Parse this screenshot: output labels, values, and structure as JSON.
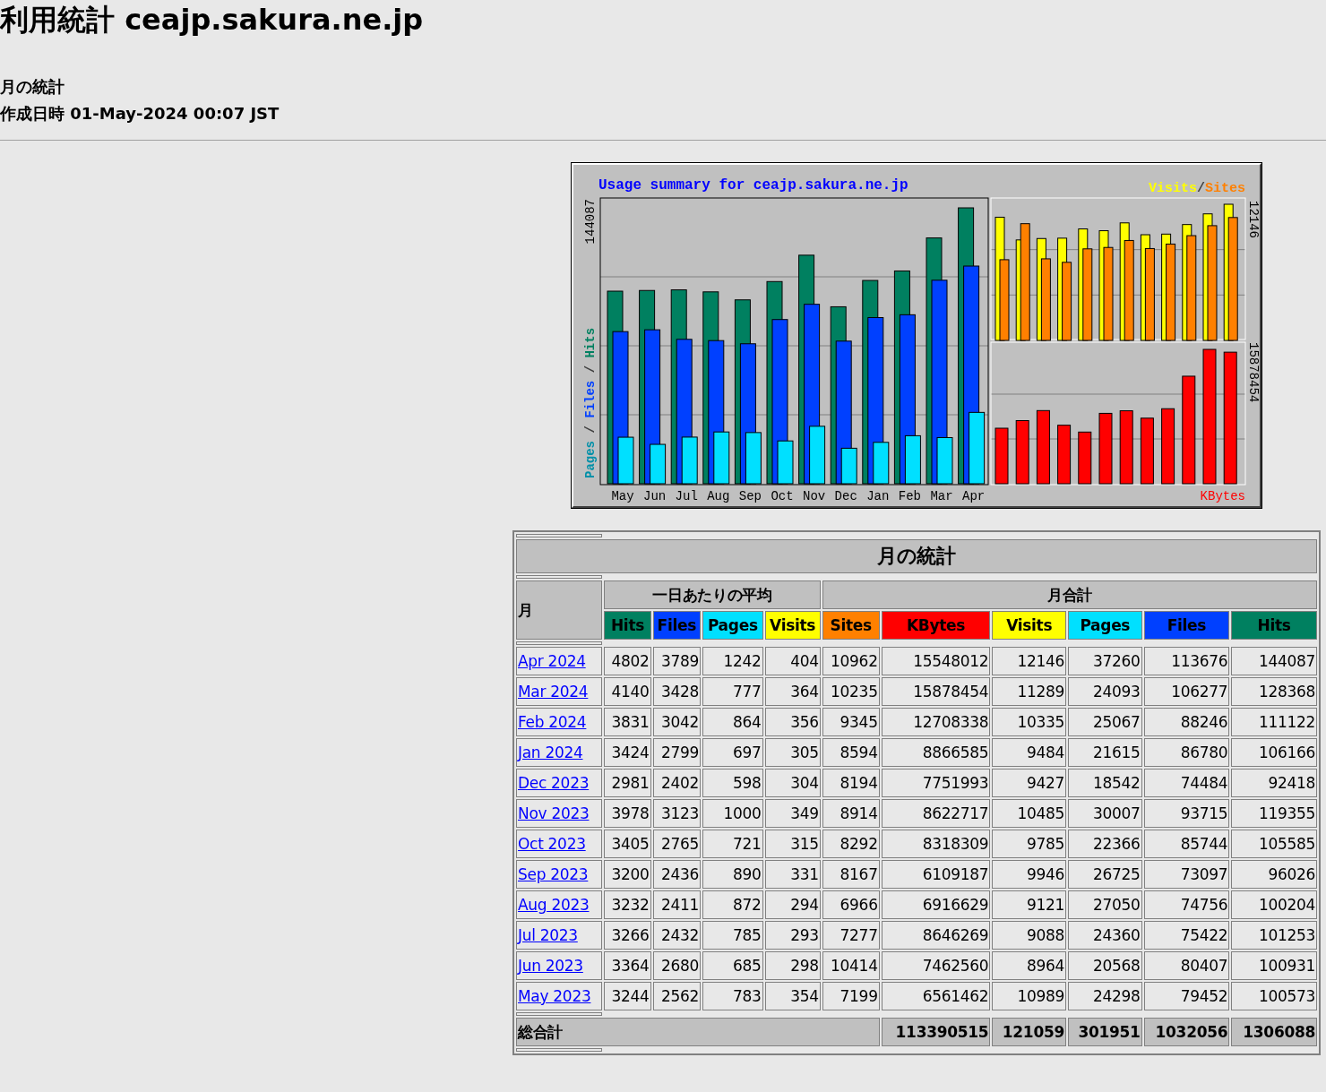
{
  "page": {
    "title": "利用統計 ceajp.sakura.ne.jp",
    "subtitle": "月の統計",
    "generated": "作成日時 01-May-2024 00:07 JST"
  },
  "chart": {
    "title": "Usage summary for ceajp.sakura.ne.jp",
    "visits_label": "Visits",
    "slash": "/",
    "sites_label": "Sites",
    "left_max": "144087",
    "left_axis": [
      {
        "text": "Pages",
        "color": "#0090a8"
      },
      {
        "text": "Files",
        "color": "#0040ff"
      },
      {
        "text": "Hits",
        "color": "#008060"
      }
    ],
    "axis_slashes": [
      "/",
      "/"
    ],
    "top_right_max": "12146",
    "bottom_right_max": "15878454",
    "kbytes_label": "KBytes",
    "months": [
      "May",
      "Jun",
      "Jul",
      "Aug",
      "Sep",
      "Oct",
      "Nov",
      "Dec",
      "Jan",
      "Feb",
      "Mar",
      "Apr"
    ]
  },
  "table": {
    "title": "月の統計",
    "month_header": "月",
    "daily_header": "一日あたりの平均",
    "monthly_header": "月合計",
    "columns": [
      {
        "label": "Hits",
        "color": "#008060"
      },
      {
        "label": "Files",
        "color": "#0040ff"
      },
      {
        "label": "Pages",
        "color": "#00e0ff"
      },
      {
        "label": "Visits",
        "color": "#ffff00"
      },
      {
        "label": "Sites",
        "color": "#ff8000"
      },
      {
        "label": "KBytes",
        "color": "#ff0000"
      },
      {
        "label": "Visits",
        "color": "#ffff00"
      },
      {
        "label": "Pages",
        "color": "#00e0ff"
      },
      {
        "label": "Files",
        "color": "#0040ff"
      },
      {
        "label": "Hits",
        "color": "#008060"
      }
    ],
    "rows": [
      {
        "month": "Apr 2024",
        "values": [
          "4802",
          "3789",
          "1242",
          "404",
          "10962",
          "15548012",
          "12146",
          "37260",
          "113676",
          "144087"
        ]
      },
      {
        "month": "Mar 2024",
        "values": [
          "4140",
          "3428",
          "777",
          "364",
          "10235",
          "15878454",
          "11289",
          "24093",
          "106277",
          "128368"
        ]
      },
      {
        "month": "Feb 2024",
        "values": [
          "3831",
          "3042",
          "864",
          "356",
          "9345",
          "12708338",
          "10335",
          "25067",
          "88246",
          "111122"
        ]
      },
      {
        "month": "Jan 2024",
        "values": [
          "3424",
          "2799",
          "697",
          "305",
          "8594",
          "8866585",
          "9484",
          "21615",
          "86780",
          "106166"
        ]
      },
      {
        "month": "Dec 2023",
        "values": [
          "2981",
          "2402",
          "598",
          "304",
          "8194",
          "7751993",
          "9427",
          "18542",
          "74484",
          "92418"
        ]
      },
      {
        "month": "Nov 2023",
        "values": [
          "3978",
          "3123",
          "1000",
          "349",
          "8914",
          "8622717",
          "10485",
          "30007",
          "93715",
          "119355"
        ]
      },
      {
        "month": "Oct 2023",
        "values": [
          "3405",
          "2765",
          "721",
          "315",
          "8292",
          "8318309",
          "9785",
          "22366",
          "85744",
          "105585"
        ]
      },
      {
        "month": "Sep 2023",
        "values": [
          "3200",
          "2436",
          "890",
          "331",
          "8167",
          "6109187",
          "9946",
          "26725",
          "73097",
          "96026"
        ]
      },
      {
        "month": "Aug 2023",
        "values": [
          "3232",
          "2411",
          "872",
          "294",
          "6966",
          "6916629",
          "9121",
          "27050",
          "74756",
          "100204"
        ]
      },
      {
        "month": "Jul 2023",
        "values": [
          "3266",
          "2432",
          "785",
          "293",
          "7277",
          "8646269",
          "9088",
          "24360",
          "75422",
          "101253"
        ]
      },
      {
        "month": "Jun 2023",
        "values": [
          "3364",
          "2680",
          "685",
          "298",
          "10414",
          "7462560",
          "8964",
          "20568",
          "80407",
          "100931"
        ]
      },
      {
        "month": "May 2023",
        "values": [
          "3244",
          "2562",
          "783",
          "354",
          "7199",
          "6561462",
          "10989",
          "24298",
          "79452",
          "100573"
        ]
      }
    ],
    "total_label": "総合計",
    "totals": [
      "113390515",
      "121059",
      "301951",
      "1032056",
      "1306088"
    ]
  }
}
